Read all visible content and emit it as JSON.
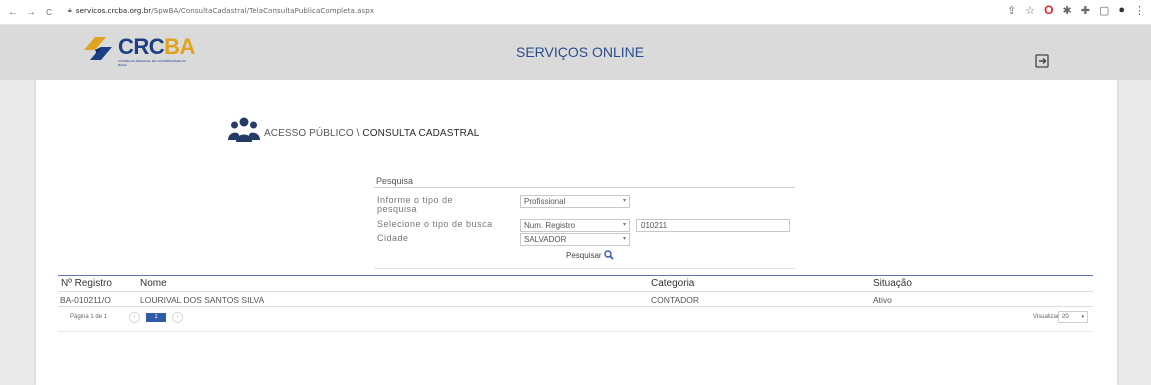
{
  "browser": {
    "back": "←",
    "forward": "→",
    "reload": "C",
    "url_host": "servicos.crcba.org.br",
    "url_path": "/SpwBA/ConsultaCadastral/TelaConsultaPublicaCompleta.aspx",
    "extension_icons": [
      "share-icon",
      "star-icon",
      "opera-icon",
      "pin-icon",
      "puzzle-icon",
      "window-icon",
      "profile-icon",
      "menu-icon"
    ]
  },
  "header": {
    "logo_text_a": "CRC",
    "logo_text_b": "BA",
    "logo_sub": "CONSELHO REGIONAL DE CONTABILIDADE DA BAHIA",
    "site_title": "SERVIÇOS ONLINE"
  },
  "breadcrumb": {
    "section": "ACESSO PÚBLICO \\",
    "current": "CONSULTA CADASTRAL"
  },
  "search": {
    "title": "Pesquisa",
    "label_type": "Informe o tipo de pesquisa",
    "label_type_l1": "Informe o tipo de",
    "label_type_l2": "pesquisa",
    "value_type": "Profissional",
    "label_search_by": "Selecione o tipo de busca",
    "value_search_by": "Num. Registro",
    "value_registro": "010211",
    "label_city": "Cidade",
    "value_city": "SALVADOR",
    "button": "Pesquisar"
  },
  "table": {
    "headers": [
      "Nº Registro",
      "Nome",
      "Categoria",
      "Situação"
    ],
    "rows": [
      [
        "BA-010211/O",
        "LOURIVAL DOS SANTOS SILVA",
        "CONTADOR",
        "Ativo"
      ]
    ]
  },
  "pagination": {
    "label": "Página 1 de 1",
    "current_page": "1",
    "view_label": "Visualizar",
    "view_value": "20"
  },
  "colors": {
    "brand_blue": "#1d3f86",
    "brand_gold": "#e1a31f",
    "accent": "#2e5aa8"
  }
}
